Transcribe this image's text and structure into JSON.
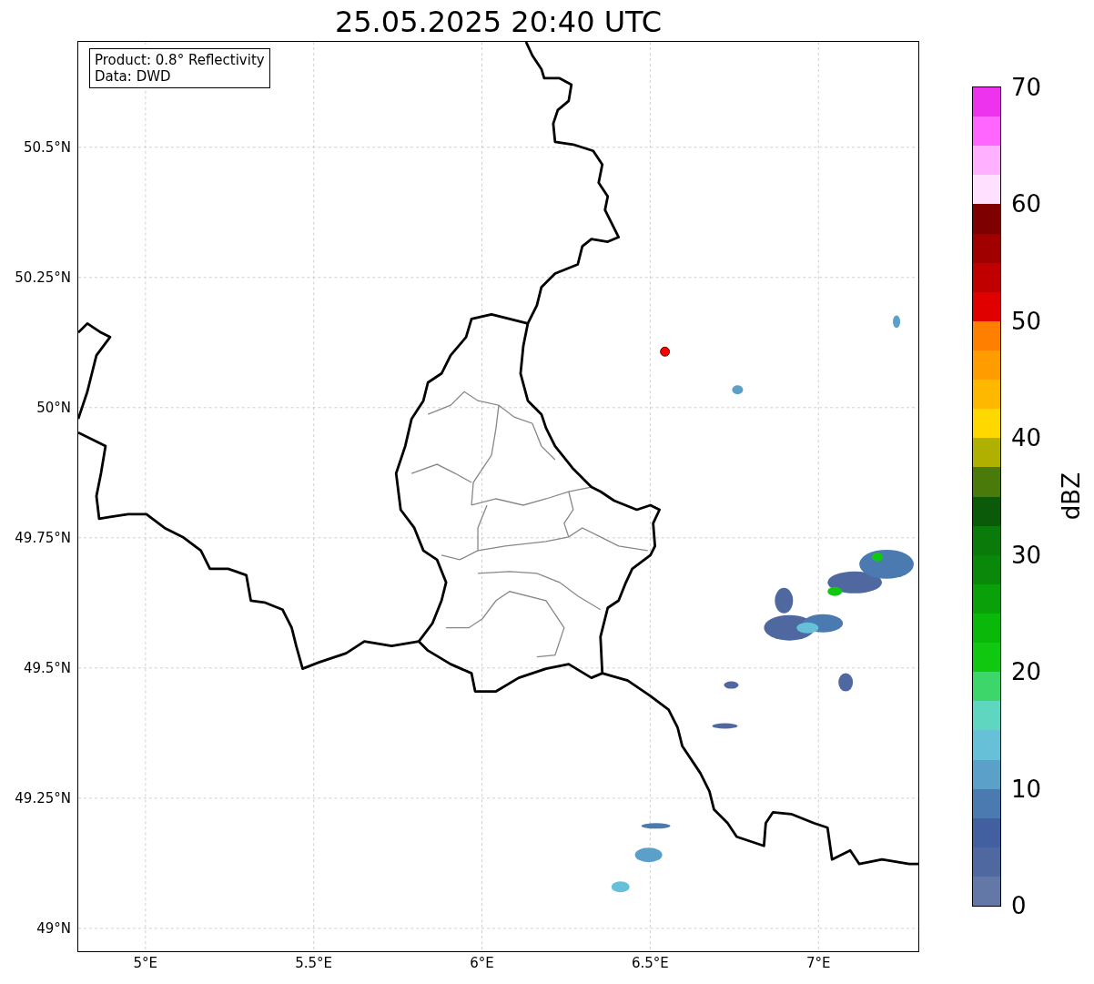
{
  "title": "25.05.2025 20:40 UTC",
  "info_box": [
    "Product: 0.8° Reflectivity",
    "Data: DWD"
  ],
  "map": {
    "xticks": [
      "5°E",
      "5.5°E",
      "6°E",
      "6.5°E",
      "7°E"
    ],
    "yticks": [
      "50.5°N",
      "50.25°N",
      "50°N",
      "49.75°N",
      "49.5°N",
      "49.25°N",
      "49°N"
    ],
    "marker": {
      "color": "#ff0000"
    }
  },
  "colorbar": {
    "label": "dBZ",
    "ticks": [
      "70",
      "60",
      "50",
      "40",
      "30",
      "20",
      "10",
      "0"
    ],
    "bands": [
      {
        "color": "#ee33ee"
      },
      {
        "color": "#ff66ff"
      },
      {
        "color": "#ffb0ff"
      },
      {
        "color": "#ffe0ff"
      },
      {
        "color": "#7f0000"
      },
      {
        "color": "#a00000"
      },
      {
        "color": "#c00000"
      },
      {
        "color": "#e00000"
      },
      {
        "color": "#ff7f00"
      },
      {
        "color": "#ff9c00"
      },
      {
        "color": "#ffb800"
      },
      {
        "color": "#ffd800"
      },
      {
        "color": "#b0b000"
      },
      {
        "color": "#4a7a0a"
      },
      {
        "color": "#0a5a0a"
      },
      {
        "color": "#0a7a0a"
      },
      {
        "color": "#0a880a"
      },
      {
        "color": "#0aa00a"
      },
      {
        "color": "#0ab80a"
      },
      {
        "color": "#10c810"
      },
      {
        "color": "#3dd66b"
      },
      {
        "color": "#5fd6c0"
      },
      {
        "color": "#65c0d8"
      },
      {
        "color": "#5aa0c8"
      },
      {
        "color": "#4a7ab0"
      },
      {
        "color": "#4260a0"
      },
      {
        "color": "#5068a0"
      },
      {
        "color": "#6478a8"
      }
    ]
  }
}
